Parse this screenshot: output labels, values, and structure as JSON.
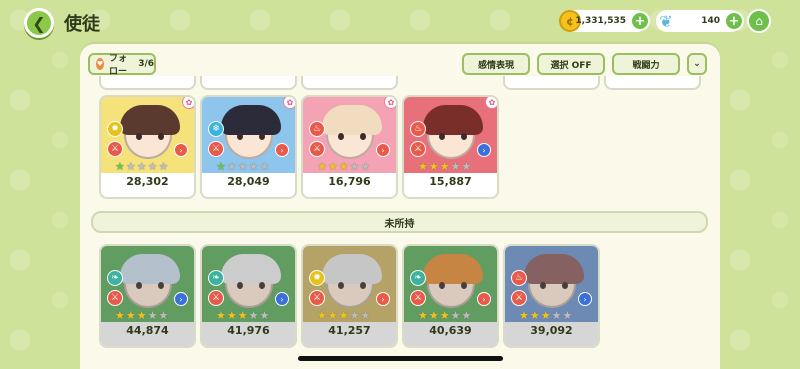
{
  "header": {
    "title": "使徒",
    "currency": [
      {
        "icon": "coin-icon",
        "value": "1,331,535"
      },
      {
        "icon": "feather-gem-icon",
        "value": "140"
      }
    ]
  },
  "toolbar": {
    "follow_label": "フォロー",
    "follow_count": "3/6",
    "emotion_button": "感情表現",
    "select_button": "選択 OFF",
    "power_button": "戦闘力"
  },
  "owned_cards": [
    {
      "power": "28,302",
      "bg": "#f6e27a",
      "hair": "#5a3a2e",
      "element": "sun-icon",
      "element_color": "#e6c21a",
      "class_color": "#e85a4a",
      "stars": 1,
      "star_color": "green"
    },
    {
      "power": "28,049",
      "bg": "#8ec5ec",
      "hair": "#2b2b3a",
      "element": "snowflake-icon",
      "element_color": "#3cb2e0",
      "class_color": "#e85a4a",
      "stars": 1,
      "star_color": "green"
    },
    {
      "power": "16,796",
      "bg": "#f3a3b3",
      "hair": "#f2dcc0",
      "element": "fire-icon",
      "element_color": "#e85a4a",
      "class_color": "#e85a4a",
      "stars": 3,
      "star_color": "gold"
    },
    {
      "power": "15,887",
      "bg": "#e8707a",
      "hair": "#7a2e2a",
      "element": "fire-icon",
      "element_color": "#e85a4a",
      "class_color": "#3a70d8",
      "stars": 3,
      "star_color": "gold"
    }
  ],
  "section": {
    "unowned_label": "未所持"
  },
  "unowned_cards": [
    {
      "power": "44,874",
      "bg": "#5aa85a",
      "hair": "#c8d8e8",
      "element": "leaf-icon",
      "element_color": "#3cb2a0",
      "class_color": "#3a70d8",
      "stars": 3
    },
    {
      "power": "41,976",
      "bg": "#5aa85a",
      "hair": "#e8e8e8",
      "element": "leaf-icon",
      "element_color": "#3cb2a0",
      "class_color": "#3a70d8",
      "stars": 3
    },
    {
      "power": "41,257",
      "bg": "#c8b060",
      "hair": "#e0e0e0",
      "element": "sun-icon",
      "element_color": "#e6c21a",
      "class_color": "#e85a4a",
      "stars": 3
    },
    {
      "power": "40,639",
      "bg": "#5aa85a",
      "hair": "#e08a30",
      "element": "leaf-icon",
      "element_color": "#3cb2a0",
      "class_color": "#e85a4a",
      "stars": 3
    },
    {
      "power": "39,092",
      "bg": "#6a90c8",
      "hair": "#8a5a5a",
      "element": "fire-icon",
      "element_color": "#e85a4a",
      "class_color": "#3a70d8",
      "stars": 3
    }
  ]
}
